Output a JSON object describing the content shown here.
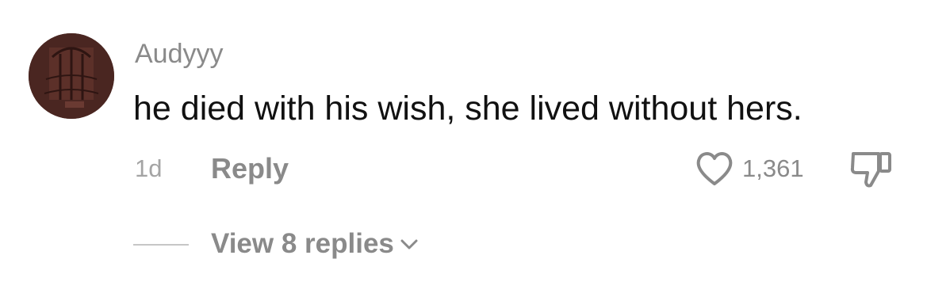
{
  "comment": {
    "avatar_icon": "user-avatar",
    "username": "Audyyy",
    "text": "he died with his wish, she lived without hers.",
    "timestamp": "1d",
    "reply_label": "Reply",
    "like_icon": "heart-outline",
    "like_count": "1,361",
    "dislike_icon": "thumbs-down-outline",
    "replies_label": "View 8 replies",
    "replies_icon": "chevron-down",
    "colors": {
      "primary_text": "#111111",
      "secondary_text": "#8a8a8a",
      "avatar_bg": "#4a2621"
    }
  }
}
